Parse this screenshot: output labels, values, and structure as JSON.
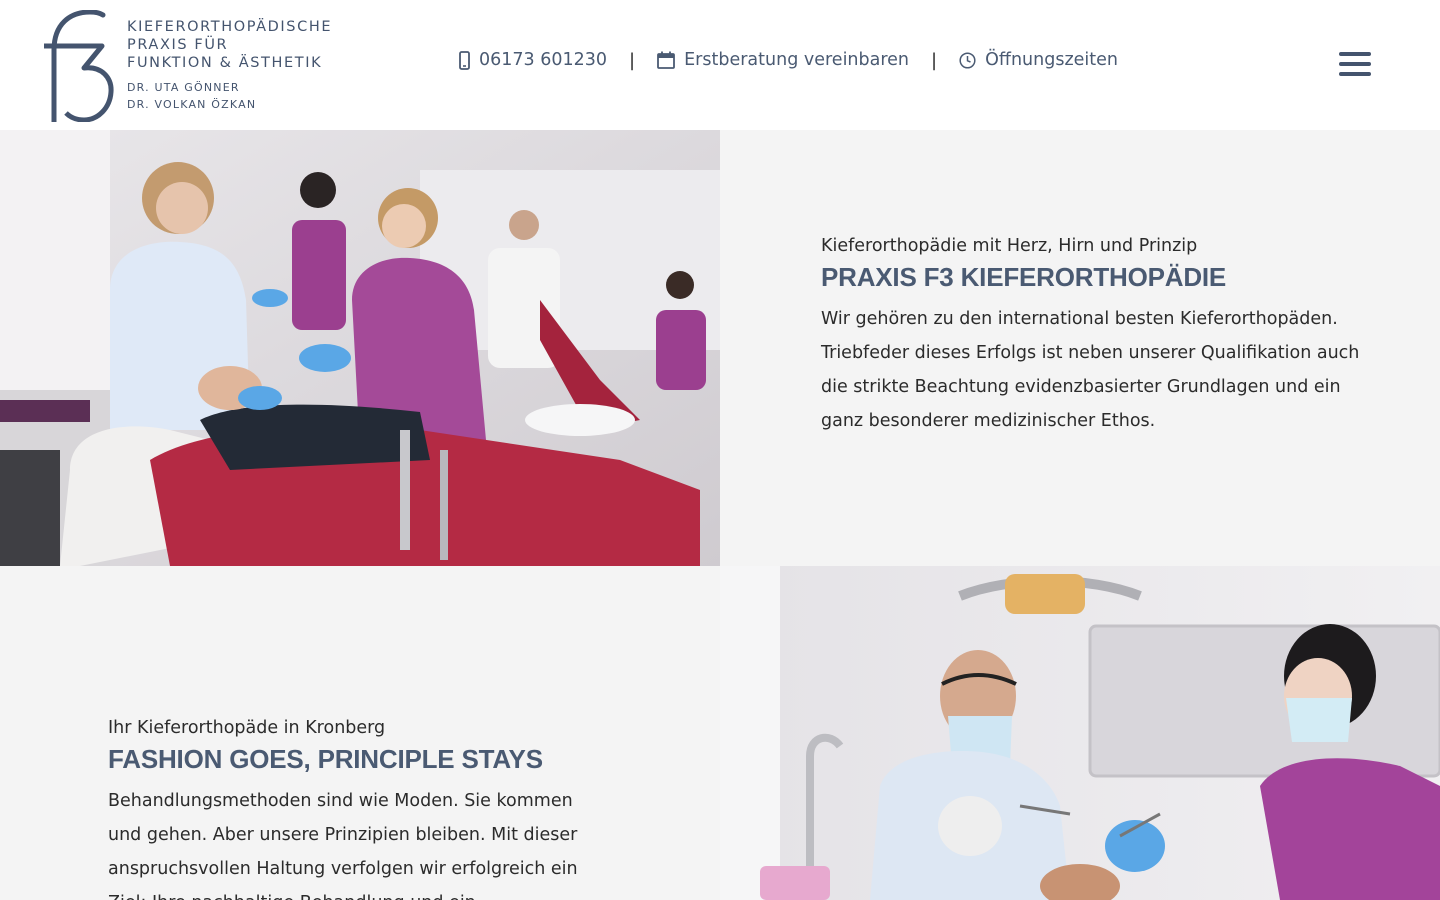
{
  "header": {
    "logo": {
      "mark_text": "f3",
      "lines": [
        "KIEFERORTHOPÄDISCHE",
        "PRAXIS FÜR",
        "FUNKTION & ÄSTHETIK"
      ],
      "doctors": [
        "DR. UTA GÖNNER",
        "DR. VOLKAN ÖZKAN"
      ]
    },
    "nav": {
      "phone": "06173 601230",
      "appointment": "Erstberatung vereinbaren",
      "hours": "Öffnungszeiten",
      "separator": "|"
    },
    "menu_icon": "hamburger-menu-icon"
  },
  "section1": {
    "kicker": "Kieferorthopädie mit Herz, Hirn und Prinzip",
    "title": "PRAXIS F3 KIEFERORTHOPÄDIE",
    "body": "Wir gehören zu den international besten Kieferorthopäden. Triebfeder dieses Erfolgs ist neben unserer Qualifikation auch die strikte Beachtung evidenzbasierter Grundlagen und ein ganz besonderer medizinischer Ethos."
  },
  "section2": {
    "kicker": "Ihr Kieferorthopäde in Kronberg",
    "title": "FASHION GOES, PRINCIPLE STAYS",
    "body": "Behandlungsmethoden sind wie Moden. Sie kommen und gehen. Aber unsere Prinzipien bleiben. Mit dieser anspruchsvollen Haltung verfolgen wir erfolgreich ein Ziel: Ihre nachhaltige Behandlung und ein"
  },
  "colors": {
    "brand": "#44546e",
    "panel_bg": "#f4f4f4",
    "accent_purple": "#9b3f8f"
  }
}
